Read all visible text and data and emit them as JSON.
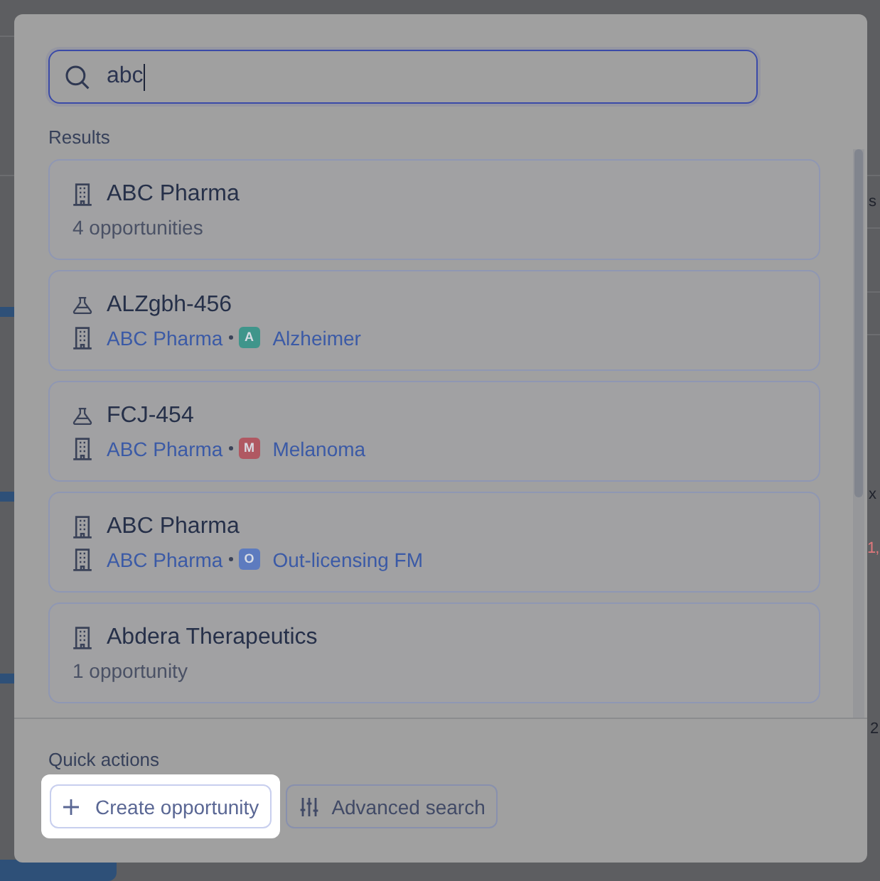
{
  "background": {
    "fragments": [
      {
        "text": "s",
        "kind": "plain"
      },
      {
        "text": "x",
        "kind": "plain"
      },
      {
        "text": "1,",
        "kind": "alert"
      },
      {
        "text": "2",
        "kind": "plain"
      }
    ]
  },
  "search": {
    "value": "abc",
    "focused": true
  },
  "results": {
    "label": "Results",
    "items": [
      {
        "kind": "company",
        "title": "ABC Pharma",
        "subtitle": "4 opportunities"
      },
      {
        "kind": "asset",
        "title": "ALZgbh-456",
        "company": "ABC Pharma",
        "tag": {
          "letter": "A",
          "color": "#3f958b",
          "label": "Alzheimer"
        }
      },
      {
        "kind": "asset",
        "title": "FCJ-454",
        "company": "ABC Pharma",
        "tag": {
          "letter": "M",
          "color": "#b05862",
          "label": "Melanoma"
        }
      },
      {
        "kind": "opportunity",
        "title": "ABC Pharma",
        "company": "ABC Pharma",
        "tag": {
          "letter": "O",
          "color": "#5d7bbf",
          "label": "Out-licensing FM"
        }
      },
      {
        "kind": "company",
        "title": "Abdera Therapeutics",
        "subtitle": "1 opportunity"
      }
    ]
  },
  "quick_actions": {
    "label": "Quick actions",
    "buttons": [
      {
        "kind": "create",
        "label": "Create opportunity",
        "highlighted": true
      },
      {
        "kind": "filter",
        "label": "Advanced search",
        "highlighted": false
      }
    ]
  }
}
